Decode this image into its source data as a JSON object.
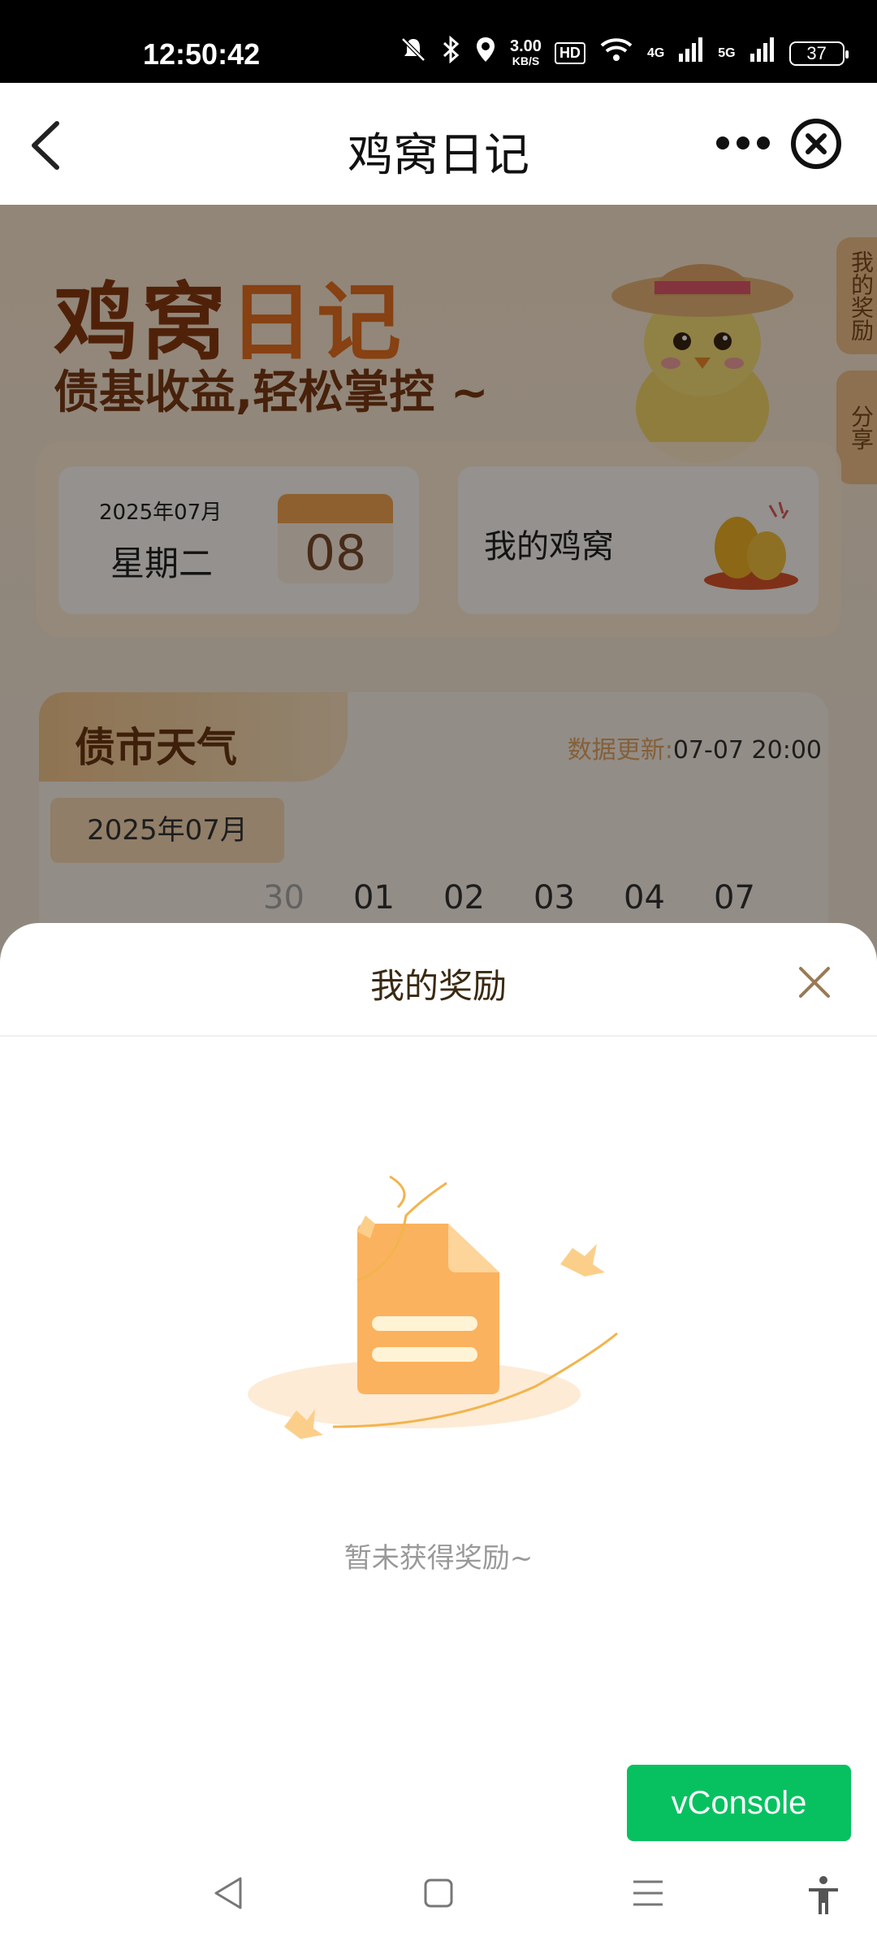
{
  "status_bar": {
    "time": "12:50:42",
    "speed_value": "3.00",
    "speed_unit": "KB/S",
    "hd": "HD",
    "net1": "4G",
    "net2": "5G",
    "battery": "37"
  },
  "nav": {
    "title": "鸡窝日记"
  },
  "hero": {
    "title_part1": "鸡窝",
    "title_part2": "日记",
    "subtitle": "债基收益,轻松掌控 ~"
  },
  "side_tabs": {
    "reward": "我的奖励",
    "share": "分享"
  },
  "date_card": {
    "year_month": "2025年07月",
    "weekday": "星期二",
    "day": "08"
  },
  "nest_card": {
    "label": "我的鸡窝"
  },
  "weather": {
    "title": "债市天气",
    "update_label": "数据更新:",
    "update_time": "07-07 20:00",
    "month": "2025年07月",
    "days": [
      "30",
      "01",
      "02",
      "03",
      "04",
      "07"
    ]
  },
  "sheet": {
    "title": "我的奖励",
    "empty_text": "暂未获得奖励~"
  },
  "vconsole": {
    "label": "vConsole"
  },
  "colors": {
    "accent_orange": "#e8711f",
    "brand_brown": "#8a3a10",
    "vconsole_green": "#07c160"
  }
}
